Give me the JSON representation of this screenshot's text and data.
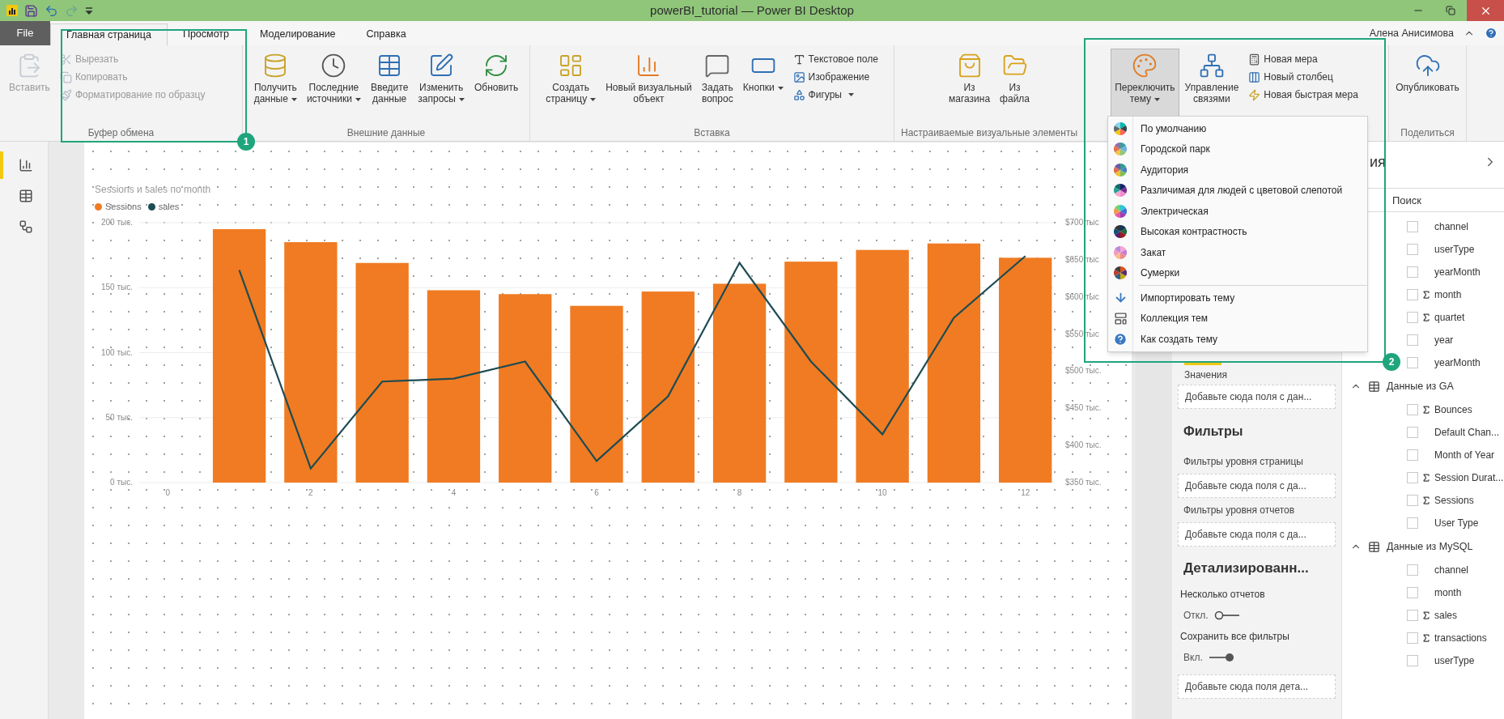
{
  "window": {
    "title": "powerBI_tutorial — Power BI Desktop"
  },
  "quick_access": [
    {
      "kind": "save",
      "disabled": false
    },
    {
      "kind": "undo",
      "disabled": false
    },
    {
      "kind": "redo",
      "disabled": true
    },
    {
      "kind": "customize",
      "disabled": false
    }
  ],
  "menu_tabs": [
    {
      "kind": "file",
      "label": "File",
      "selected": false
    },
    {
      "kind": "tab",
      "label": "Главная страница",
      "selected": true
    },
    {
      "kind": "tab",
      "label": "Просмотр",
      "selected": false
    },
    {
      "kind": "tab",
      "label": "Моделирование",
      "selected": false
    },
    {
      "kind": "tab",
      "label": "Справка",
      "selected": false
    }
  ],
  "user": {
    "name": "Алена Анисимова"
  },
  "ribbon": {
    "groups": [
      {
        "label": "Буфер обмена",
        "items": [
          {
            "kind": "large",
            "lines": [
              "Вставить"
            ],
            "dropdown": false,
            "disabled": true,
            "pressed": false
          },
          {
            "kind": "small",
            "lines": [
              "Вырезать"
            ],
            "dropdown": false,
            "disabled": true,
            "pressed": false
          },
          {
            "kind": "small",
            "lines": [
              "Копировать"
            ],
            "dropdown": false,
            "disabled": true,
            "pressed": false
          },
          {
            "kind": "small",
            "lines": [
              "Форматирование по образцу"
            ],
            "dropdown": false,
            "disabled": true,
            "pressed": false
          }
        ]
      },
      {
        "label": "Внешние данные",
        "items": [
          {
            "kind": "large",
            "lines": [
              "Получить",
              "данные"
            ],
            "dropdown": true,
            "disabled": false,
            "pressed": false
          },
          {
            "kind": "large",
            "lines": [
              "Последние",
              "источники"
            ],
            "dropdown": true,
            "disabled": false,
            "pressed": false
          },
          {
            "kind": "large",
            "lines": [
              "Введите",
              "данные"
            ],
            "dropdown": false,
            "disabled": false,
            "pressed": false
          },
          {
            "kind": "large",
            "lines": [
              "Изменить",
              "запросы"
            ],
            "dropdown": true,
            "disabled": false,
            "pressed": false
          },
          {
            "kind": "large",
            "lines": [
              "Обновить"
            ],
            "dropdown": false,
            "disabled": false,
            "pressed": false
          }
        ]
      },
      {
        "label": "Вставка",
        "items": [
          {
            "kind": "large",
            "lines": [
              "Создать",
              "страницу"
            ],
            "dropdown": true,
            "disabled": false,
            "pressed": false
          },
          {
            "kind": "large",
            "lines": [
              "Новый визуальный",
              "объект"
            ],
            "dropdown": false,
            "disabled": false,
            "pressed": false
          },
          {
            "kind": "large",
            "lines": [
              "Задать",
              "вопрос"
            ],
            "dropdown": false,
            "disabled": false,
            "pressed": false
          },
          {
            "kind": "large",
            "lines": [
              "Кнопки"
            ],
            "dropdown": true,
            "disabled": false,
            "pressed": false
          },
          {
            "kind": "small",
            "lines": [
              "Текстовое поле"
            ],
            "dropdown": false,
            "disabled": false,
            "pressed": false
          },
          {
            "kind": "small",
            "lines": [
              "Изображение"
            ],
            "dropdown": false,
            "disabled": false,
            "pressed": false
          },
          {
            "kind": "small",
            "lines": [
              "Фигуры"
            ],
            "dropdown": true,
            "disabled": false,
            "pressed": false
          }
        ]
      },
      {
        "label": "Настраиваемые визуальные элементы",
        "items": [
          {
            "kind": "large",
            "lines": [
              "Из",
              "магазина"
            ],
            "dropdown": false,
            "disabled": false,
            "pressed": false
          },
          {
            "kind": "large",
            "lines": [
              "Из",
              "файла"
            ],
            "dropdown": false,
            "disabled": false,
            "pressed": false
          }
        ]
      },
      {
        "items": [
          {
            "kind": "large",
            "lines": [
              "Переключить",
              "тему"
            ],
            "dropdown": true,
            "disabled": false,
            "pressed": true
          },
          {
            "kind": "large",
            "lines": [
              "Управление",
              "связями"
            ],
            "dropdown": false,
            "disabled": false,
            "pressed": false
          },
          {
            "kind": "small",
            "lines": [
              "Новая мера"
            ],
            "dropdown": false,
            "disabled": false,
            "pressed": false
          },
          {
            "kind": "small",
            "lines": [
              "Новый столбец"
            ],
            "dropdown": false,
            "disabled": false,
            "pressed": false
          },
          {
            "kind": "small",
            "lines": [
              "Новая быстрая мера"
            ],
            "dropdown": false,
            "disabled": false,
            "pressed": false
          }
        ]
      },
      {
        "label": "Поделиться",
        "items": [
          {
            "kind": "large",
            "lines": [
              "Опубликовать"
            ],
            "dropdown": false,
            "disabled": false,
            "pressed": false
          }
        ]
      }
    ]
  },
  "nav": [
    {
      "selected": true
    },
    {
      "selected": false
    },
    {
      "selected": false
    }
  ],
  "chart": {
    "chart_data": {
      "type": "bar",
      "title": "Sessions и sales по month",
      "x": [
        1,
        2,
        3,
        4,
        5,
        6,
        7,
        8,
        9,
        10,
        11,
        12
      ],
      "grid": true,
      "legend": true,
      "xlim": [
        -0.4,
        12.4
      ],
      "xticks": [
        0,
        2,
        4,
        6,
        8,
        10,
        12
      ],
      "ylim": [
        0,
        200
      ],
      "yticks": [
        {
          "value": 0,
          "label": "0 тыс."
        },
        {
          "value": 50,
          "label": "50 тыс."
        },
        {
          "value": 100,
          "label": "100 тыс."
        },
        {
          "value": 150,
          "label": "150 тыс."
        },
        {
          "value": 200,
          "label": "200 тыс."
        }
      ],
      "y2lim": [
        350,
        700
      ],
      "y2ticks": [
        {
          "value": 350,
          "label": "$350 тыс."
        },
        {
          "value": 400,
          "label": "$400 тыс."
        },
        {
          "value": 450,
          "label": "$450 тыс."
        },
        {
          "value": 500,
          "label": "$500 тыс."
        },
        {
          "value": 550,
          "label": "$550 тыс"
        },
        {
          "value": 600,
          "label": "$600 тыс"
        },
        {
          "value": 650,
          "label": "$650 тыс"
        },
        {
          "value": 700,
          "label": "$700 тыс"
        }
      ],
      "series": [
        {
          "name": "Sessions",
          "color": "#f07b22",
          "values": [
            195,
            185,
            169,
            148,
            145,
            136,
            147,
            153,
            170,
            179,
            184,
            173
          ]
        },
        {
          "name": "sales",
          "color": "#1d4b53",
          "type": "line",
          "axis": "y2",
          "values": [
            636,
            369,
            486,
            490,
            513,
            379,
            466,
            646,
            513,
            415,
            572,
            655
          ]
        }
      ]
    }
  },
  "theme_menu": {
    "items": [
      {
        "kind": "theme",
        "label": "По умолчанию"
      },
      {
        "kind": "theme",
        "label": "Городской парк"
      },
      {
        "kind": "theme",
        "label": "Аудитория"
      },
      {
        "kind": "theme",
        "label": "Различимая для людей с цветовой слепотой"
      },
      {
        "kind": "theme",
        "label": "Электрическая"
      },
      {
        "kind": "theme",
        "label": "Высокая контрастность"
      },
      {
        "kind": "theme",
        "label": "Закат"
      },
      {
        "kind": "theme",
        "label": "Сумерки"
      },
      {
        "kind": "import",
        "label": "Импортировать тему"
      },
      {
        "kind": "gallery",
        "label": "Коллекция тем"
      },
      {
        "kind": "help",
        "label": "Как создать тему"
      }
    ]
  },
  "visual_pane": {
    "values_label": "Значения",
    "values_drop": "Добавьте сюда поля с дан...",
    "filters": {
      "title": "Фильтры",
      "sections": [
        {
          "label": "Фильтры уровня страницы",
          "drop": "Добавьте сюда поля с да..."
        },
        {
          "label": "Фильтры уровня отчетов",
          "drop": "Добавьте сюда поля с да..."
        }
      ]
    },
    "drillthrough": {
      "title": "Детализированн...",
      "toggles": [
        {
          "label": "Несколько отчетов",
          "state": "Откл.",
          "on": false
        },
        {
          "label": "Сохранить все фильтры",
          "state": "Вкл.",
          "on": true
        }
      ],
      "drop": "Добавьте сюда поля дета..."
    }
  },
  "fields_pane": {
    "header": "ия",
    "search": {
      "placeholder": "Поиск"
    },
    "fields": [
      {
        "name": "channel",
        "aggregate": false,
        "checked": false
      },
      {
        "name": "userType",
        "aggregate": false,
        "checked": false
      },
      {
        "name": "yearMonth",
        "aggregate": false,
        "checked": false
      },
      {
        "name": "month",
        "aggregate": true,
        "checked": false
      },
      {
        "name": "quartet",
        "aggregate": true,
        "checked": false
      },
      {
        "name": "year",
        "aggregate": false,
        "checked": false
      },
      {
        "name": "yearMonth",
        "aggregate": false,
        "checked": false
      }
    ],
    "tables": [
      {
        "name": "Данные из GA",
        "expanded": true,
        "fields": [
          {
            "name": "Bounces",
            "aggregate": true,
            "checked": false
          },
          {
            "name": "Default Chan...",
            "aggregate": false,
            "checked": false
          },
          {
            "name": "Month of Year",
            "aggregate": false,
            "checked": false
          },
          {
            "name": "Session Durat...",
            "aggregate": true,
            "checked": false
          },
          {
            "name": "Sessions",
            "aggregate": true,
            "checked": false
          },
          {
            "name": "User Type",
            "aggregate": false,
            "checked": false
          }
        ]
      },
      {
        "name": "Данные из MySQL",
        "expanded": true,
        "fields": [
          {
            "name": "channel",
            "aggregate": false,
            "checked": false
          },
          {
            "name": "month",
            "aggregate": false,
            "checked": false
          },
          {
            "name": "sales",
            "aggregate": true,
            "checked": false
          },
          {
            "name": "transactions",
            "aggregate": true,
            "checked": false
          },
          {
            "name": "userType",
            "aggregate": false,
            "checked": false
          }
        ]
      }
    ]
  },
  "annotations": [
    {
      "label": "1"
    },
    {
      "label": "2"
    }
  ]
}
